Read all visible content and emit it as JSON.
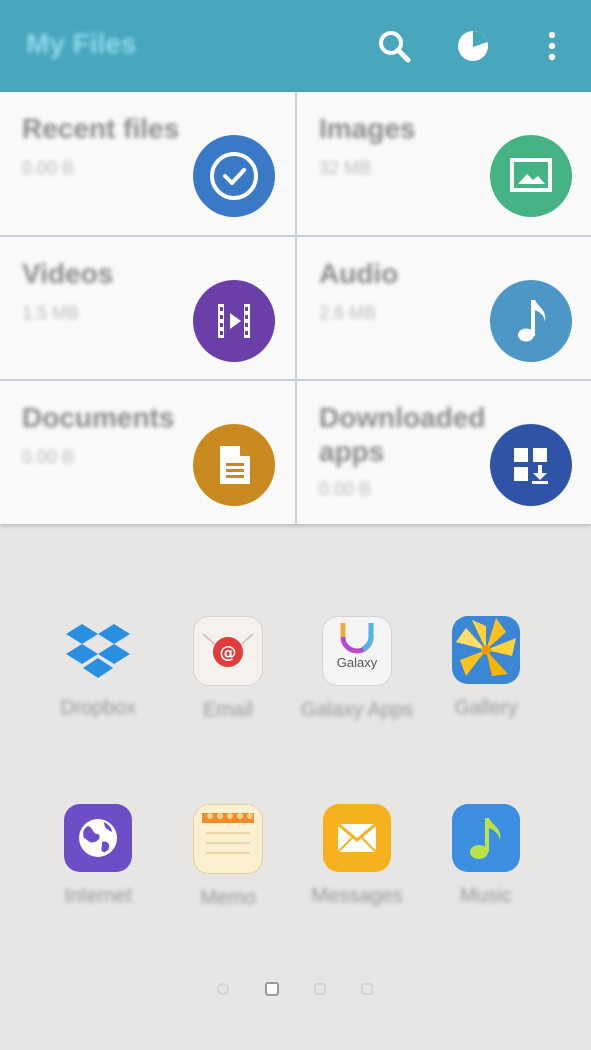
{
  "appbar": {
    "title": "My Files"
  },
  "categories": [
    {
      "name": "Recent files",
      "size": "0.00 B",
      "icon": "clock-check-icon",
      "color": "#3a79c6"
    },
    {
      "name": "Images",
      "size": "32 MB",
      "icon": "image-icon",
      "color": "#45b384"
    },
    {
      "name": "Videos",
      "size": "1.5 MB",
      "icon": "video-film-icon",
      "color": "#6a3fa8"
    },
    {
      "name": "Audio",
      "size": "2.6 MB",
      "icon": "music-note-icon",
      "color": "#4d97c6"
    },
    {
      "name": "Documents",
      "size": "0.00 B",
      "icon": "document-icon",
      "color": "#c98b1f"
    },
    {
      "name": "Downloaded apps",
      "size": "0.00 B",
      "icon": "download-apps-icon",
      "color": "#2f54a7"
    }
  ],
  "apps": [
    {
      "label": "Dropbox",
      "icon": "dropbox-icon"
    },
    {
      "label": "Email",
      "icon": "email-icon"
    },
    {
      "label": "Galaxy Apps",
      "icon": "galaxy-apps-icon",
      "badge": "Galaxy"
    },
    {
      "label": "Gallery",
      "icon": "gallery-icon"
    },
    {
      "label": "Internet",
      "icon": "internet-icon"
    },
    {
      "label": "Memo",
      "icon": "memo-icon"
    },
    {
      "label": "Messages",
      "icon": "messages-icon"
    },
    {
      "label": "Music",
      "icon": "music-icon"
    }
  ],
  "pages": {
    "count": 4,
    "current": 2
  }
}
